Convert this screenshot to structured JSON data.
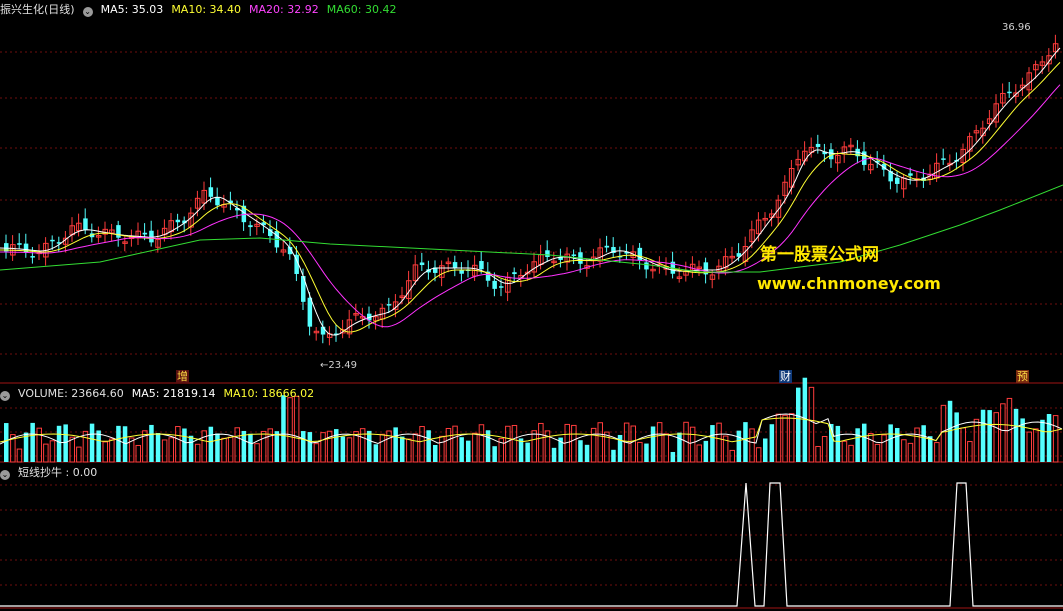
{
  "colors": {
    "up": "#ff3c3c",
    "down": "#54ffff",
    "ma5": "#ffffff",
    "ma10": "#ffff33",
    "ma20": "#ff33ff",
    "ma60": "#33dd33",
    "grid": "#6e0e0e",
    "panelLine": "#a01414",
    "signal": "#ffffff",
    "watermark": "#ffe800"
  },
  "main": {
    "stock_title": "振兴生化(日线)",
    "ma5": "MA5: 35.03",
    "ma10": "MA10: 34.40",
    "ma20": "MA20: 32.92",
    "ma60": "MA60: 30.42",
    "high_label": "36.96",
    "low_label": "←23.49",
    "tags": {
      "zeng": "增",
      "cai": "财",
      "yu": "预"
    }
  },
  "volume": {
    "label": "VOLUME: 23664.60",
    "ma5": "MA5: 21819.14",
    "ma10": "MA10: 18666.02"
  },
  "indicator": {
    "label": "短线抄牛 : 0.00"
  },
  "watermark": {
    "cn": "第一股票公式网",
    "url": "www.chnmoney.com"
  },
  "icons": [
    "collapse-circle-icon"
  ]
}
